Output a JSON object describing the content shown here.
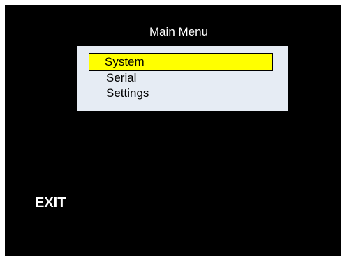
{
  "header": {
    "title": "Main Menu"
  },
  "menu": {
    "items": [
      {
        "label": "System",
        "selected": true
      },
      {
        "label": "Serial",
        "selected": false
      },
      {
        "label": "Settings",
        "selected": false
      }
    ]
  },
  "footer": {
    "exit_label": "EXIT"
  },
  "colors": {
    "background": "#000000",
    "panel": "#e6ecf4",
    "highlight": "#ffff00",
    "text_light": "#ffffff",
    "text_dark": "#000000"
  }
}
